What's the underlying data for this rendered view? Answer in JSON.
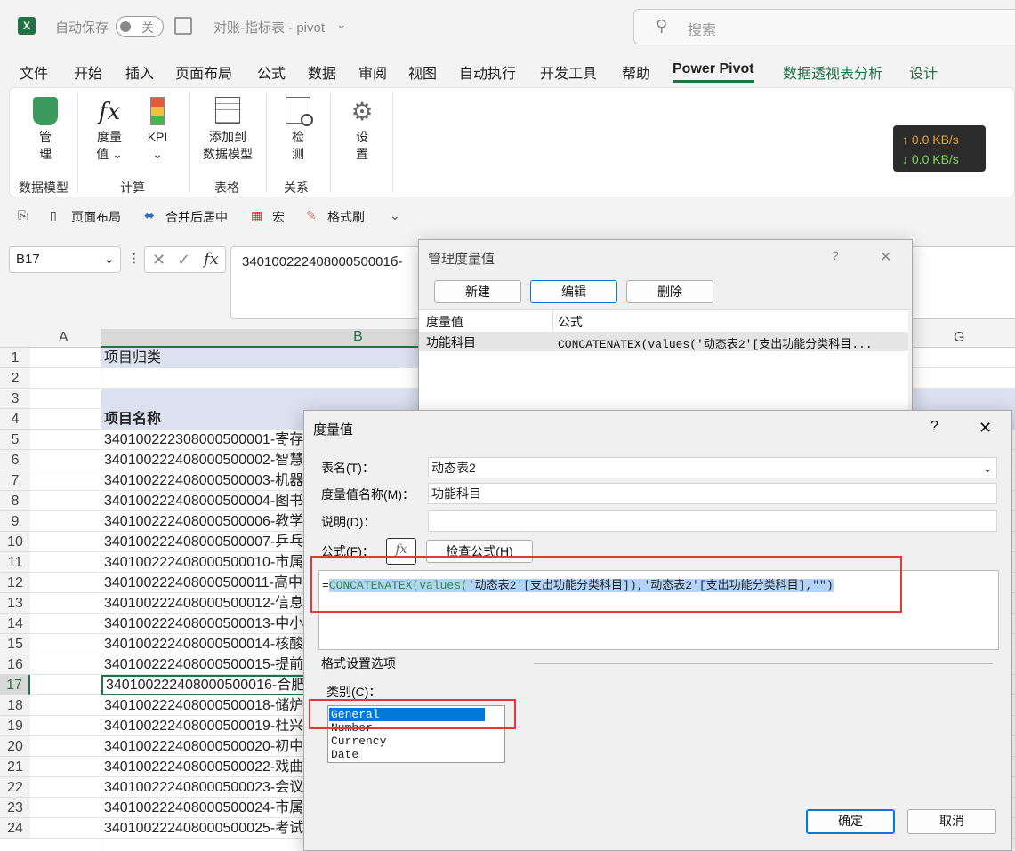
{
  "title": {
    "autosave_label": "自动保存",
    "toggle_label": "关",
    "doc_name": "对账-指标表 - pivot",
    "search_placeholder": "搜索"
  },
  "tabs": [
    "文件",
    "开始",
    "插入",
    "页面布局",
    "公式",
    "数据",
    "审阅",
    "视图",
    "自动执行",
    "开发工具",
    "帮助",
    "Power Pivot",
    "数据透视表分析",
    "设计"
  ],
  "ribbon": {
    "manage": {
      "l1": "管",
      "l2": "理"
    },
    "measure": {
      "l1": "度量",
      "l2": "值 ⌄"
    },
    "kpi": {
      "l1": "KPI",
      "l2": "⌄"
    },
    "add": {
      "l1": "添加到",
      "l2": "数据模型"
    },
    "detect": {
      "l1": "检",
      "l2": "测"
    },
    "settings": {
      "l1": "设",
      "l2": "置"
    },
    "groups": [
      "数据模型",
      "计算",
      "表格",
      "关系"
    ],
    "net": {
      "up": "↑ 0.0 KB/s",
      "down": "↓ 0.0 KB/s"
    }
  },
  "qat": {
    "layout": "页面布局",
    "merge": "合并后居中",
    "macro": "宏",
    "painter": "格式刷"
  },
  "formula_bar": {
    "cell_ref": "B17",
    "content": "34010022240800050001б-"
  },
  "sheet": {
    "columns": [
      "A",
      "B",
      "G"
    ],
    "row_numbers": [
      "1",
      "2",
      "3",
      "4",
      "5",
      "6",
      "7",
      "8",
      "9",
      "10",
      "11",
      "12",
      "13",
      "14",
      "15",
      "16",
      "17",
      "18",
      "19",
      "20",
      "21",
      "22",
      "23",
      "24"
    ],
    "cells": [
      "项目归类",
      "",
      "",
      "项目名称",
      "340100222308000500001-寄存",
      "340100222408000500002-智慧",
      "340100222408000500003-机器",
      "340100222408000500004-图书",
      "340100222408000500006-教学",
      "340100222408000500007-乒乓",
      "340100222408000500010-市属",
      "340100222408000500011-高中",
      "340100222408000500012-信息",
      "340100222408000500013-中小",
      "340100222408000500014-核酸",
      "340100222408000500015-提前",
      "340100222408000500016-合肥",
      "340100222408000500018-储炉",
      "340100222408000500019-杜兴",
      "340100222408000500020-初中",
      "340100222408000500022-戏曲",
      "340100222408000500023-会议",
      "340100222408000500024-市属",
      "340100222408000500025-考试"
    ]
  },
  "manage_dialog": {
    "title": "管理度量值",
    "help": "?",
    "close": "✕",
    "btn_new": "新建",
    "btn_edit": "编辑",
    "btn_delete": "删除",
    "col_measure": "度量值",
    "col_formula": "公式",
    "row_name": "功能科目",
    "row_formula": "CONCATENATEX(values('动态表2'[支出功能分类科目..."
  },
  "measure_dialog": {
    "title": "度量值",
    "help": "?",
    "close": "✕",
    "table_label": "表名(T)：",
    "table_value": "动态表2",
    "name_label": "度量值名称(M)：",
    "name_value": "功能科目",
    "desc_label": "说明(D)：",
    "desc_value": "",
    "formula_label": "公式(F)：",
    "fx": "fx",
    "check_btn": "检查公式(H)",
    "formula_eq": "=",
    "formula_fn": "CONCATENATEX(values(",
    "formula_rest": "'动态表2'[支出功能分类科目]),'动态表2'[支出功能分类科目],\"\")",
    "format_section": "格式设置选项",
    "category_label": "类别(C)：",
    "categories": [
      "General",
      "Number",
      "Currency",
      "Date"
    ],
    "ok": "确定",
    "cancel": "取消"
  },
  "colors": {
    "excel_green": "#217346",
    "highlight": "#0078d7",
    "annotation": "#e03a3a"
  }
}
